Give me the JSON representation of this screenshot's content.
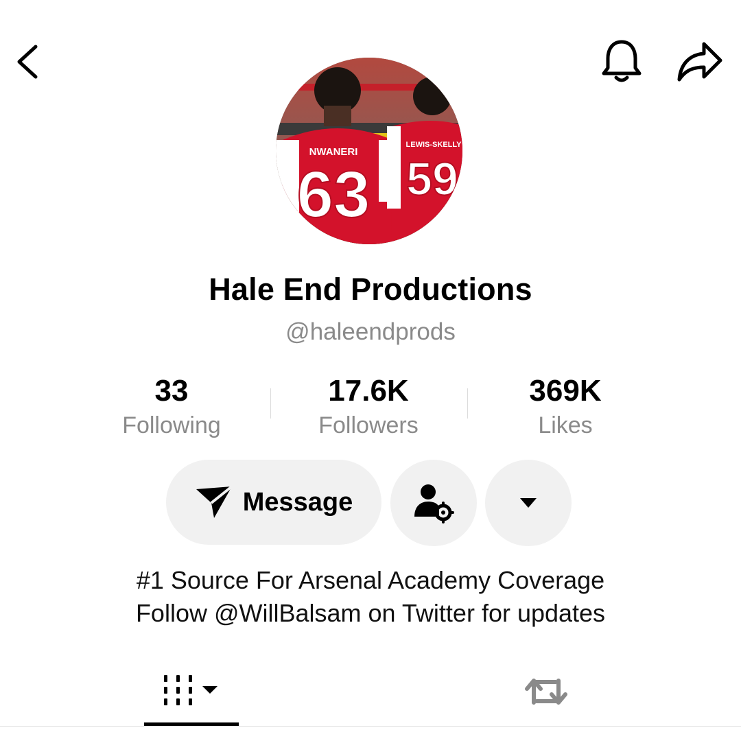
{
  "header": {
    "back_icon": "chevron-left-icon",
    "bell_icon": "bell-icon",
    "share_icon": "share-arrow-icon"
  },
  "profile": {
    "display_name": "Hale End Productions",
    "username": "@haleendprods",
    "avatar": {
      "jersey_left_name": "NWANERI",
      "jersey_left_number": "63",
      "jersey_right_name": "LEWIS-SKELLY",
      "jersey_right_number": "59"
    }
  },
  "stats": {
    "following": {
      "value": "33",
      "label": "Following"
    },
    "followers": {
      "value": "17.6K",
      "label": "Followers"
    },
    "likes": {
      "value": "369K",
      "label": "Likes"
    }
  },
  "actions": {
    "message_label": "Message",
    "message_icon": "send-icon",
    "friend_icon": "user-settings-icon",
    "more_icon": "caret-down-icon"
  },
  "bio": {
    "line1": "#1 Source For Arsenal Academy Coverage",
    "line2": "Follow @WillBalsam on Twitter for updates"
  },
  "tabs": {
    "videos_icon": "grid-columns-icon",
    "reposts_icon": "repost-icon",
    "active": "videos"
  },
  "colors": {
    "accent": "#000000",
    "muted_text": "#8a8a8a",
    "button_bg": "#f1f1f1",
    "jersey_red": "#d3122b"
  }
}
